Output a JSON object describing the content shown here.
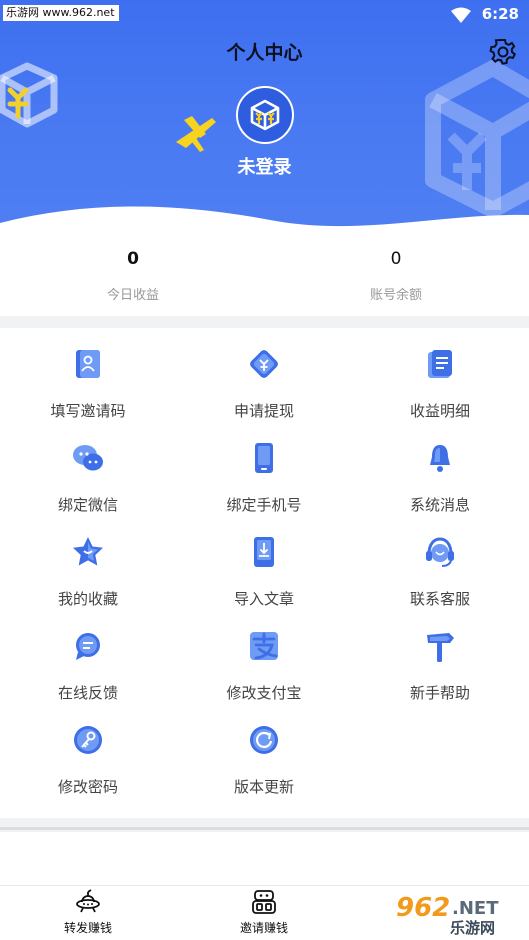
{
  "status_bar": {
    "watermark": "乐游网 www.962.net",
    "time": "6:28"
  },
  "header": {
    "title": "个人中心",
    "login_status": "未登录"
  },
  "stats": {
    "today_income": {
      "value": "0",
      "label": "今日收益"
    },
    "balance": {
      "value": "0",
      "label": "账号余额"
    }
  },
  "menu": {
    "items": [
      {
        "label": "填写邀请码",
        "icon": "invite-code-icon"
      },
      {
        "label": "申请提现",
        "icon": "withdraw-icon"
      },
      {
        "label": "收益明细",
        "icon": "income-detail-icon"
      },
      {
        "label": "绑定微信",
        "icon": "wechat-icon"
      },
      {
        "label": "绑定手机号",
        "icon": "phone-icon"
      },
      {
        "label": "系统消息",
        "icon": "bell-icon"
      },
      {
        "label": "我的收藏",
        "icon": "star-icon"
      },
      {
        "label": "导入文章",
        "icon": "import-article-icon"
      },
      {
        "label": "联系客服",
        "icon": "headset-icon"
      },
      {
        "label": "在线反馈",
        "icon": "feedback-icon"
      },
      {
        "label": "修改支付宝",
        "icon": "alipay-icon"
      },
      {
        "label": "新手帮助",
        "icon": "signpost-icon"
      },
      {
        "label": "修改密码",
        "icon": "key-icon"
      },
      {
        "label": "版本更新",
        "icon": "refresh-icon"
      }
    ]
  },
  "tabbar": {
    "tabs": [
      {
        "label": "转发赚钱",
        "icon": "ufo-icon"
      },
      {
        "label": "邀请赚钱",
        "icon": "robot-icon"
      }
    ]
  },
  "watermark_bottom": {
    "text1": "962",
    "text2": ".NET",
    "text3": "乐游网"
  },
  "colors": {
    "header_top": "#3d6ff0",
    "accent": "#3f6fe6",
    "icon_light": "#6f9bf5",
    "plane": "#f5d31f"
  }
}
